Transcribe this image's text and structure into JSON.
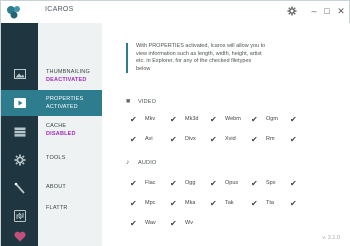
{
  "window": {
    "title": "ICAROS",
    "buttons": {
      "settings_icon": "gear-icon",
      "minimize": "–",
      "maximize": "□",
      "close": "✕"
    },
    "accent_color": "#2e7d8f",
    "nav_bg": "#eef2f3",
    "rail_bg": "#1f3640",
    "status_color": "#a42dbb"
  },
  "rail": [
    {
      "icon": "image-icon",
      "active": false
    },
    {
      "icon": "play-icon",
      "active": true
    },
    {
      "icon": "stack-icon",
      "active": false
    },
    {
      "icon": "gear-icon",
      "active": false
    },
    {
      "icon": "wand-icon",
      "active": false
    },
    {
      "icon": "flattr-icon",
      "active": false
    },
    {
      "icon": "heart-icon",
      "active": false
    }
  ],
  "nav": [
    {
      "title": "THUMBNAILING",
      "status": "DEACTIVATED",
      "active": false
    },
    {
      "title": "PROPERTIES",
      "status": "ACTIVATED",
      "active": true
    },
    {
      "title": "CACHE",
      "status": "DISABLED",
      "active": false
    },
    {
      "title": "TOOLS",
      "status": "",
      "active": false
    },
    {
      "title": "ABOUT",
      "status": "",
      "active": false
    },
    {
      "title": "FLATTR",
      "status": "",
      "active": false
    }
  ],
  "info_text": "With  PROPERTIES  activated, Icaros will allow you to view information such as length, width, height, artist etc. in Explorer, for any of the checked filetypes below",
  "video": {
    "heading": "VIDEO",
    "items": [
      [
        "Mkv",
        "Mk3d",
        "Webm",
        "Ogm",
        ""
      ],
      [
        "Avi",
        "Divx",
        "Xvid",
        "Rm",
        ""
      ]
    ]
  },
  "audio": {
    "heading": "AUDIO",
    "items": [
      [
        "Flac",
        "Ogg",
        "Opus",
        "Spx",
        ""
      ],
      [
        "Mpc",
        "Mka",
        "Tak",
        "Tta",
        ""
      ],
      [
        "Wav",
        "Wv"
      ]
    ]
  },
  "version": "v. 3.1.0"
}
